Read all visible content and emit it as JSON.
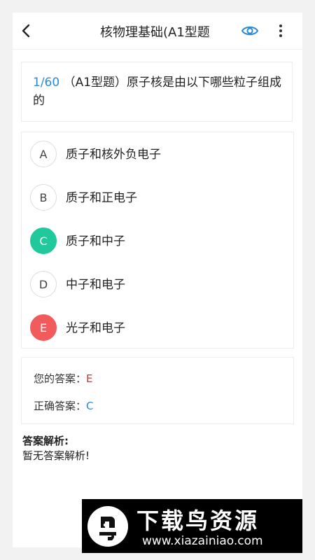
{
  "header": {
    "title": "核物理基础(A1型题",
    "icons": {
      "back": "chevron-left-icon",
      "eye": "eye-icon",
      "more": "more-vertical-icon"
    },
    "accent": "#2a8ad8"
  },
  "question": {
    "index": "1/60",
    "text": " （A1型题）原子核是由以下哪些粒子组成的"
  },
  "options": [
    {
      "letter": "A",
      "text": "质子和核外负电子",
      "state": "normal"
    },
    {
      "letter": "B",
      "text": "质子和正电子",
      "state": "normal"
    },
    {
      "letter": "C",
      "text": "质子和中子",
      "state": "correct"
    },
    {
      "letter": "D",
      "text": "中子和电子",
      "state": "normal"
    },
    {
      "letter": "E",
      "text": "光子和电子",
      "state": "wrong"
    }
  ],
  "answers": {
    "your_label": "您的答案：",
    "your_value": "E",
    "correct_label": "正确答案：",
    "correct_value": "C"
  },
  "analysis": {
    "title": "答案解析:",
    "text": "暂无答案解析!"
  },
  "watermark": {
    "brand": "下载鸟资源",
    "url": "www.xiazainiao.com"
  },
  "colors": {
    "correct": "#1fc99b",
    "wrong": "#f25b5b"
  }
}
